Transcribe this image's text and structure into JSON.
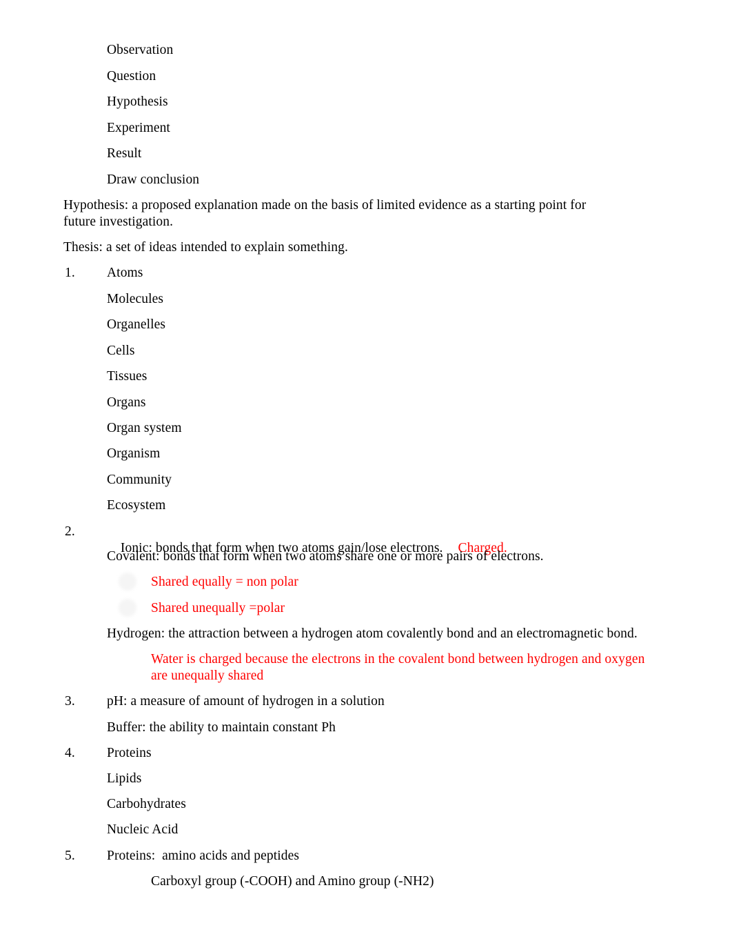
{
  "document": {
    "type": "study-notes",
    "accent_red": "#ff0000",
    "text_color": "#000000",
    "background": "#ffffff"
  },
  "scientific_method": {
    "steps": [
      "Observation",
      "Question",
      "Hypothesis",
      "Experiment",
      "Result",
      "Draw conclusion"
    ]
  },
  "definitions": {
    "hypothesis": "Hypothesis:  a proposed explanation made on the basis of limited evidence as a starting point for future investigation.",
    "thesis": "Thesis: a set of ideas intended to explain something."
  },
  "items": {
    "one": {
      "number": "1.",
      "levels": [
        "Atoms",
        "Molecules",
        "Organelles",
        "Cells",
        "Tissues",
        "Organs",
        "Organ system",
        "Organism",
        "Community",
        "Ecosystem"
      ]
    },
    "two": {
      "number": "2.",
      "ionic": "Ionic: bonds that form when two atoms gain/lose electrons.",
      "ionic_note": "Charged.",
      "covalent": "Covalent: bonds that form when two atoms share one or more pairs of electrons.",
      "covalent_notes": [
        "Shared equally = non polar",
        "Shared unequally =polar"
      ],
      "hydrogen": "Hydrogen: the attraction between a hydrogen atom covalently bond and an electromagnetic bond.",
      "hydrogen_note": "Water is charged because the electrons in the covalent bond between hydrogen and oxygen are unequally shared"
    },
    "three": {
      "number": "3.",
      "ph": "pH: a measure of amount of hydrogen in a solution",
      "buffer": "Buffer: the ability to maintain constant Ph"
    },
    "four": {
      "number": "4.",
      "macromolecules": [
        "Proteins",
        "Lipids",
        "Carbohydrates",
        "Nucleic Acid"
      ]
    },
    "five": {
      "number": "5.",
      "proteins": "Proteins:  amino acids and peptides",
      "groups": "Carboxyl group (-COOH) and Amino group (-NH2)"
    }
  }
}
